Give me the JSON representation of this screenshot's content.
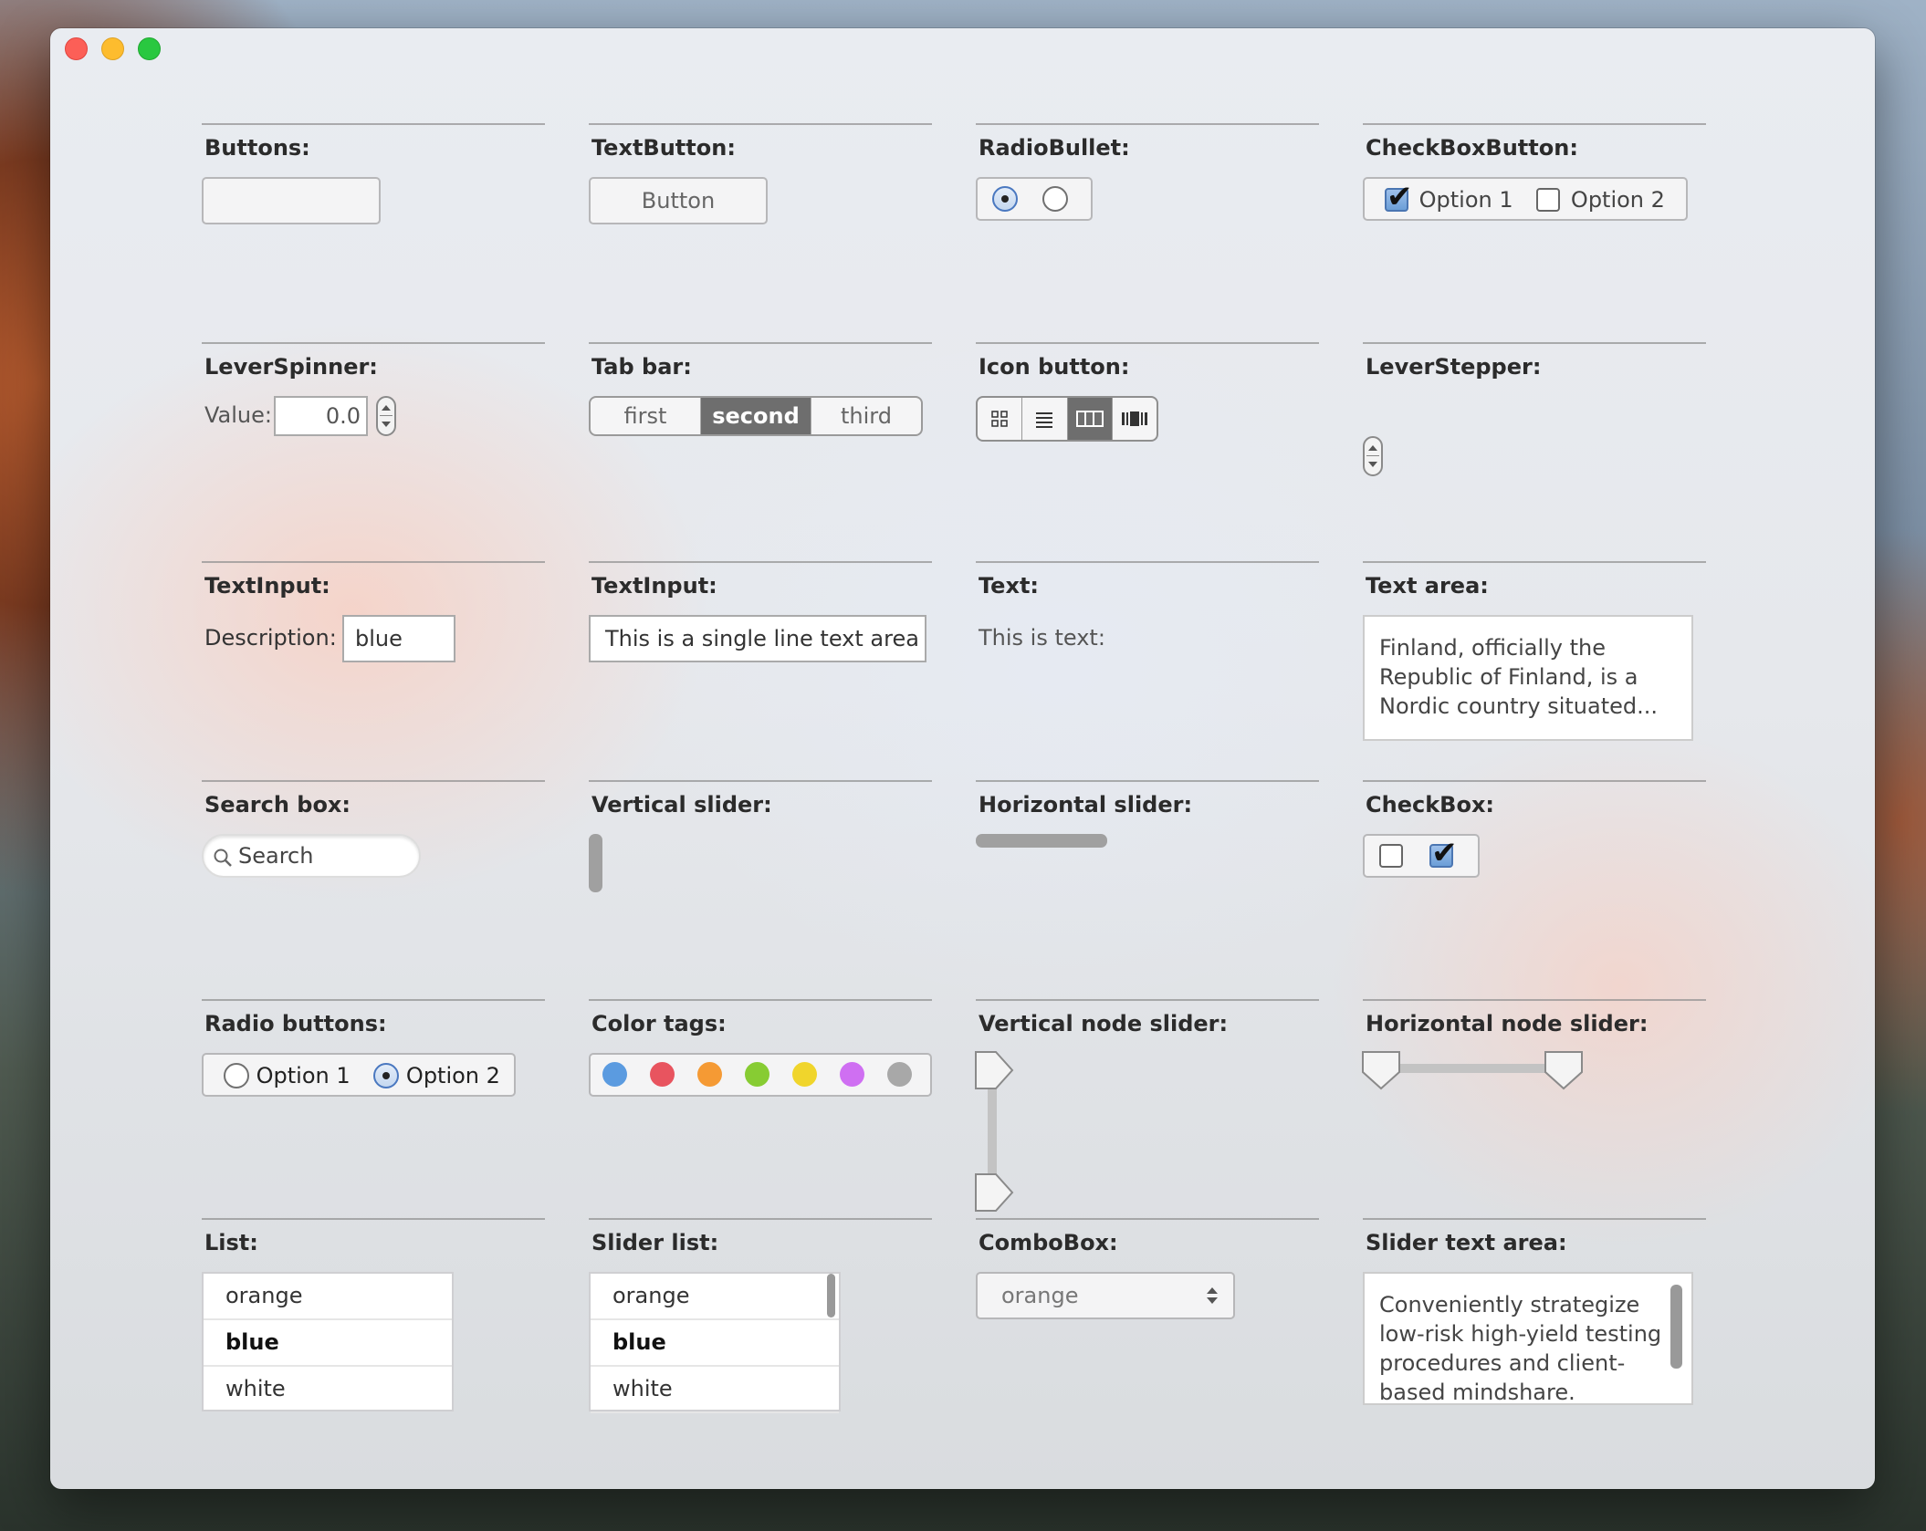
{
  "buttons": {
    "title": "Buttons:"
  },
  "text_button": {
    "title": "TextButton:",
    "label": "Button"
  },
  "radio_bullet": {
    "title": "RadioBullet:"
  },
  "checkbox_button": {
    "title": "CheckBoxButton:",
    "option1": "Option 1",
    "option2": "Option 2"
  },
  "lever_spinner": {
    "title": "LeverSpinner:",
    "value_label": "Value:",
    "value": "0.0"
  },
  "tab_bar": {
    "title": "Tab bar:",
    "tabs": [
      "first",
      "second",
      "third"
    ],
    "selected": "second"
  },
  "icon_button": {
    "title": "Icon button:",
    "icons": [
      "grid-icon",
      "list-icon",
      "columns-icon",
      "coverflow-icon"
    ]
  },
  "lever_stepper": {
    "title": "LeverStepper:"
  },
  "text_input1": {
    "title": "TextInput:",
    "label": "Description:",
    "value": "blue"
  },
  "text_input2": {
    "title": "TextInput:",
    "value": "This is a single line text area"
  },
  "text": {
    "title": "Text:",
    "value": "This is text:"
  },
  "text_area": {
    "title": "Text area:",
    "lines": [
      "Finland, officially the",
      "Republic of Finland, is a",
      "Nordic country situated..."
    ]
  },
  "search_box": {
    "title": "Search box:",
    "placeholder": "Search"
  },
  "vertical_slider": {
    "title": "Vertical slider:"
  },
  "horizontal_slider": {
    "title": "Horizontal slider:"
  },
  "checkbox": {
    "title": "CheckBox:"
  },
  "radio_buttons": {
    "title": "Radio buttons:",
    "option1": "Option 1",
    "option2": "Option 2"
  },
  "color_tags": {
    "title": "Color tags:",
    "colors": [
      "#5b9be0",
      "#e8545f",
      "#f59a34",
      "#87cc33",
      "#f0d52c",
      "#cf6ff2",
      "#a8a8a8"
    ]
  },
  "vertical_node_slider": {
    "title": "Vertical node slider:"
  },
  "horizontal_node_slider": {
    "title": "Horizontal node slider:"
  },
  "list": {
    "title": "List:",
    "items": [
      "orange",
      "blue",
      "white"
    ],
    "selected": "blue"
  },
  "slider_list": {
    "title": "Slider list:",
    "items": [
      "orange",
      "blue",
      "white"
    ],
    "selected": "blue"
  },
  "combobox": {
    "title": "ComboBox:",
    "value": "orange"
  },
  "slider_text_area": {
    "title": "Slider text area:",
    "lines": [
      "Conveniently strategize",
      "low-risk high-yield testing",
      "procedures and client-",
      "based mindshare."
    ]
  }
}
